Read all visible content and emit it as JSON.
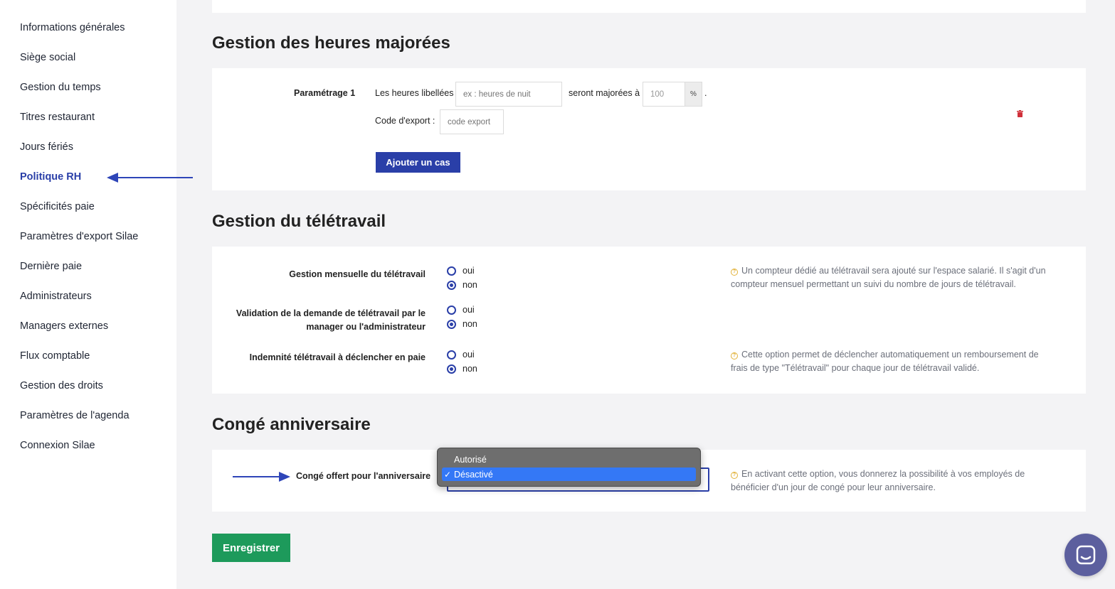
{
  "sidebar": {
    "items": [
      {
        "label": "Informations générales"
      },
      {
        "label": "Siège social"
      },
      {
        "label": "Gestion du temps"
      },
      {
        "label": "Titres restaurant"
      },
      {
        "label": "Jours fériés"
      },
      {
        "label": "Politique RH",
        "active": true
      },
      {
        "label": "Spécificités paie"
      },
      {
        "label": "Paramètres d'export Silae"
      },
      {
        "label": "Dernière paie"
      },
      {
        "label": "Administrateurs"
      },
      {
        "label": "Managers externes"
      },
      {
        "label": "Flux comptable"
      },
      {
        "label": "Gestion des droits"
      },
      {
        "label": "Paramètres de l'agenda"
      },
      {
        "label": "Connexion Silae"
      }
    ]
  },
  "overtime": {
    "title": "Gestion des heures majorées",
    "setting_label": "Paramétrage 1",
    "hours_label": "Les heures libellées",
    "hours_placeholder": "ex : heures de nuit",
    "increase_label": "seront majorées à",
    "percent_value": "100",
    "percent_unit": "%",
    "dot": ".",
    "export_label": "Code d'export :",
    "export_placeholder": "code export",
    "add_button": "Ajouter un cas"
  },
  "telework": {
    "title": "Gestion du télétravail",
    "rows": [
      {
        "label_lines": [
          "Gestion mensuelle du télétravail"
        ],
        "options": [
          {
            "label": "oui",
            "checked": false
          },
          {
            "label": "non",
            "checked": true
          }
        ],
        "help_lines": [
          "Un compteur dédié au télétravail sera ajouté sur l'espace salarié. Il s'agit d'un",
          "compteur mensuel permettant un suivi du nombre de jours de télétravail."
        ]
      },
      {
        "label_lines": [
          "Validation de la demande de télétravail par le",
          "manager ou l'administrateur"
        ],
        "options": [
          {
            "label": "oui",
            "checked": false
          },
          {
            "label": "non",
            "checked": true
          }
        ],
        "help_lines": []
      },
      {
        "label_lines": [
          "Indemnité télétravail à déclencher en paie"
        ],
        "options": [
          {
            "label": "oui",
            "checked": false
          },
          {
            "label": "non",
            "checked": true
          }
        ],
        "help_lines": [
          "Cette option permet de déclencher automatiquement un remboursement de",
          "frais de type \"Télétravail\" pour chaque jour de télétravail validé."
        ]
      }
    ]
  },
  "birthday": {
    "title": "Congé anniversaire",
    "label": "Congé offert pour l'anniversaire",
    "dropdown_options": [
      {
        "label": "Autorisé",
        "selected": false
      },
      {
        "label": "Désactivé",
        "selected": true
      }
    ],
    "check_mark": "✓",
    "help_lines": [
      "En activant cette option, vous donnerez la possibilité à vos employés de",
      "bénéficier d'un jour de congé pour leur anniversaire."
    ]
  },
  "save_button": "Enregistrer",
  "help_icon_glyph": "?",
  "colors": {
    "primary": "#2a3fa8",
    "success": "#1d9a5b",
    "danger": "#d0303a",
    "help_icon": "#e2b23a",
    "dropdown_highlight": "#3478f6"
  },
  "icons": {
    "trash": "trash-icon",
    "help": "help-icon",
    "chat": "chat-icon",
    "arrow": "arrow-icon"
  }
}
